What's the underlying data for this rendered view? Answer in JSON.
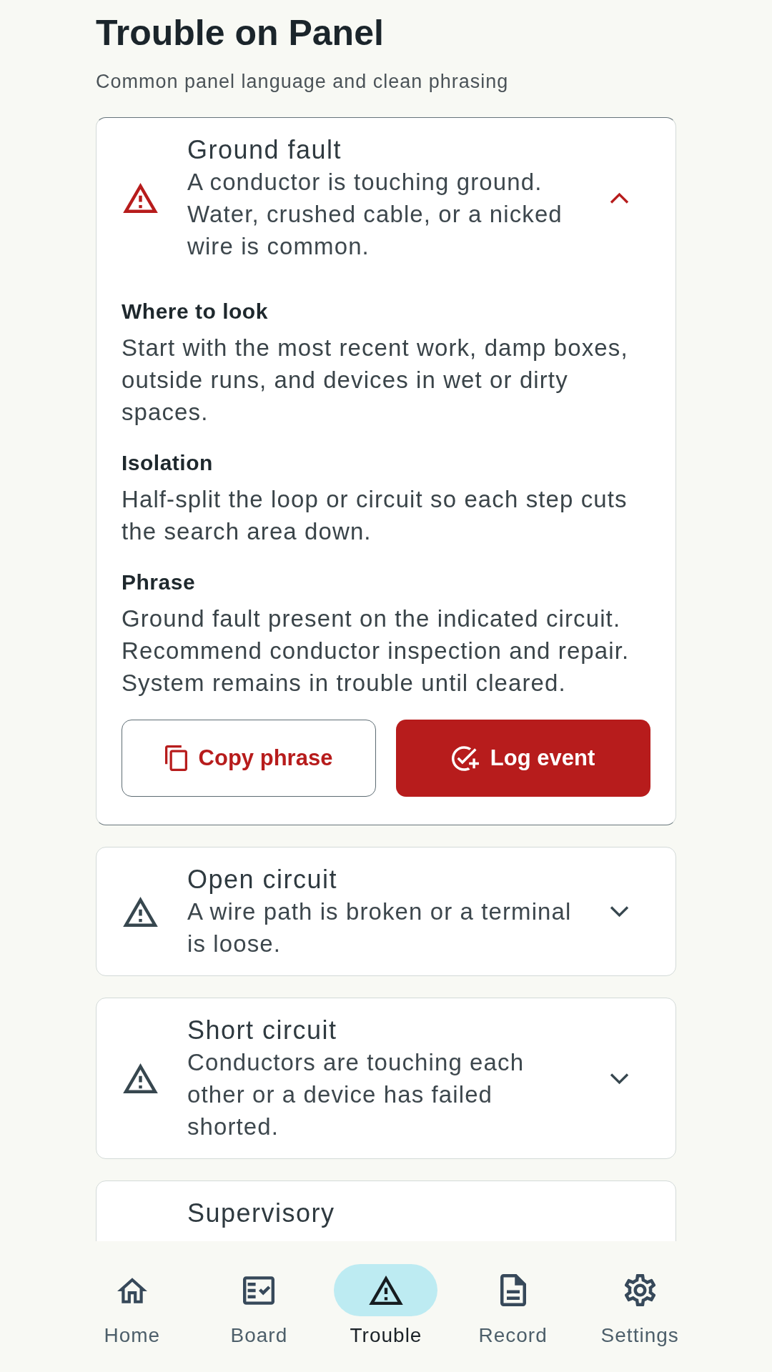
{
  "header": {
    "title": "Trouble on Panel",
    "subtitle": "Common panel language and clean phrasing"
  },
  "troubles": [
    {
      "title": "Ground fault",
      "description": "A conductor is touching ground. Water, crushed cable, or a nicked wire is common.",
      "expanded": true,
      "sections": [
        {
          "heading": "Where to look",
          "text": "Start with the most recent work, damp boxes, outside runs, and devices in wet or dirty spaces."
        },
        {
          "heading": "Isolation",
          "text": "Half-split the loop or circuit so each step cuts the search area down."
        },
        {
          "heading": "Phrase",
          "text": "Ground fault present on the indicated circuit. Recommend conductor inspection and repair. System remains in trouble until cleared."
        }
      ],
      "actions": [
        {
          "kind": "outline",
          "label": "Copy phrase"
        },
        {
          "kind": "filled",
          "label": "Log event"
        }
      ]
    },
    {
      "title": "Open circuit",
      "description": "A wire path is broken or a terminal is loose.",
      "expanded": false
    },
    {
      "title": "Short circuit",
      "description": "Conductors are touching each other or a device has failed shorted.",
      "expanded": false
    },
    {
      "title": "Supervisory"
    }
  ],
  "nav": [
    {
      "kind": "home",
      "label": "Home",
      "selected": false
    },
    {
      "kind": "board",
      "label": "Board",
      "selected": false
    },
    {
      "kind": "trouble",
      "label": "Trouble",
      "selected": true
    },
    {
      "kind": "record",
      "label": "Record",
      "selected": false
    },
    {
      "kind": "settings",
      "label": "Settings",
      "selected": false
    }
  ]
}
